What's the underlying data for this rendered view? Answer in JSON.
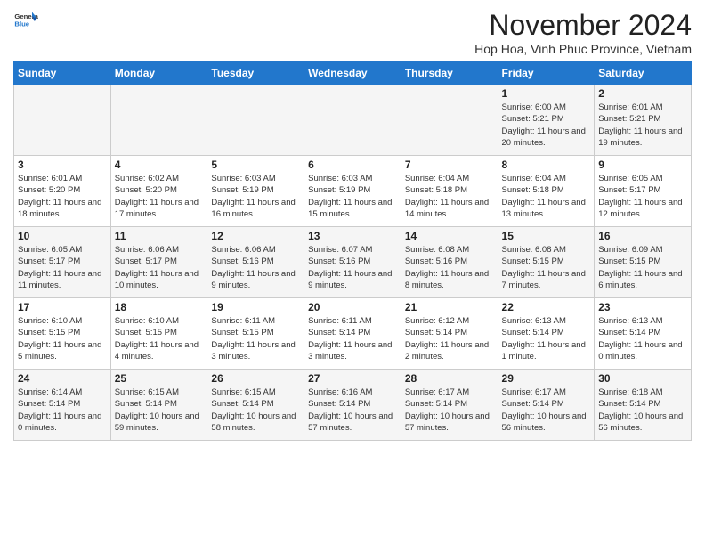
{
  "header": {
    "logo_general": "General",
    "logo_blue": "Blue",
    "month_title": "November 2024",
    "location": "Hop Hoa, Vinh Phuc Province, Vietnam"
  },
  "days_of_week": [
    "Sunday",
    "Monday",
    "Tuesday",
    "Wednesday",
    "Thursday",
    "Friday",
    "Saturday"
  ],
  "weeks": [
    [
      {
        "day": "",
        "info": ""
      },
      {
        "day": "",
        "info": ""
      },
      {
        "day": "",
        "info": ""
      },
      {
        "day": "",
        "info": ""
      },
      {
        "day": "",
        "info": ""
      },
      {
        "day": "1",
        "info": "Sunrise: 6:00 AM\nSunset: 5:21 PM\nDaylight: 11 hours and 20 minutes."
      },
      {
        "day": "2",
        "info": "Sunrise: 6:01 AM\nSunset: 5:21 PM\nDaylight: 11 hours and 19 minutes."
      }
    ],
    [
      {
        "day": "3",
        "info": "Sunrise: 6:01 AM\nSunset: 5:20 PM\nDaylight: 11 hours and 18 minutes."
      },
      {
        "day": "4",
        "info": "Sunrise: 6:02 AM\nSunset: 5:20 PM\nDaylight: 11 hours and 17 minutes."
      },
      {
        "day": "5",
        "info": "Sunrise: 6:03 AM\nSunset: 5:19 PM\nDaylight: 11 hours and 16 minutes."
      },
      {
        "day": "6",
        "info": "Sunrise: 6:03 AM\nSunset: 5:19 PM\nDaylight: 11 hours and 15 minutes."
      },
      {
        "day": "7",
        "info": "Sunrise: 6:04 AM\nSunset: 5:18 PM\nDaylight: 11 hours and 14 minutes."
      },
      {
        "day": "8",
        "info": "Sunrise: 6:04 AM\nSunset: 5:18 PM\nDaylight: 11 hours and 13 minutes."
      },
      {
        "day": "9",
        "info": "Sunrise: 6:05 AM\nSunset: 5:17 PM\nDaylight: 11 hours and 12 minutes."
      }
    ],
    [
      {
        "day": "10",
        "info": "Sunrise: 6:05 AM\nSunset: 5:17 PM\nDaylight: 11 hours and 11 minutes."
      },
      {
        "day": "11",
        "info": "Sunrise: 6:06 AM\nSunset: 5:17 PM\nDaylight: 11 hours and 10 minutes."
      },
      {
        "day": "12",
        "info": "Sunrise: 6:06 AM\nSunset: 5:16 PM\nDaylight: 11 hours and 9 minutes."
      },
      {
        "day": "13",
        "info": "Sunrise: 6:07 AM\nSunset: 5:16 PM\nDaylight: 11 hours and 9 minutes."
      },
      {
        "day": "14",
        "info": "Sunrise: 6:08 AM\nSunset: 5:16 PM\nDaylight: 11 hours and 8 minutes."
      },
      {
        "day": "15",
        "info": "Sunrise: 6:08 AM\nSunset: 5:15 PM\nDaylight: 11 hours and 7 minutes."
      },
      {
        "day": "16",
        "info": "Sunrise: 6:09 AM\nSunset: 5:15 PM\nDaylight: 11 hours and 6 minutes."
      }
    ],
    [
      {
        "day": "17",
        "info": "Sunrise: 6:10 AM\nSunset: 5:15 PM\nDaylight: 11 hours and 5 minutes."
      },
      {
        "day": "18",
        "info": "Sunrise: 6:10 AM\nSunset: 5:15 PM\nDaylight: 11 hours and 4 minutes."
      },
      {
        "day": "19",
        "info": "Sunrise: 6:11 AM\nSunset: 5:15 PM\nDaylight: 11 hours and 3 minutes."
      },
      {
        "day": "20",
        "info": "Sunrise: 6:11 AM\nSunset: 5:14 PM\nDaylight: 11 hours and 3 minutes."
      },
      {
        "day": "21",
        "info": "Sunrise: 6:12 AM\nSunset: 5:14 PM\nDaylight: 11 hours and 2 minutes."
      },
      {
        "day": "22",
        "info": "Sunrise: 6:13 AM\nSunset: 5:14 PM\nDaylight: 11 hours and 1 minute."
      },
      {
        "day": "23",
        "info": "Sunrise: 6:13 AM\nSunset: 5:14 PM\nDaylight: 11 hours and 0 minutes."
      }
    ],
    [
      {
        "day": "24",
        "info": "Sunrise: 6:14 AM\nSunset: 5:14 PM\nDaylight: 11 hours and 0 minutes."
      },
      {
        "day": "25",
        "info": "Sunrise: 6:15 AM\nSunset: 5:14 PM\nDaylight: 10 hours and 59 minutes."
      },
      {
        "day": "26",
        "info": "Sunrise: 6:15 AM\nSunset: 5:14 PM\nDaylight: 10 hours and 58 minutes."
      },
      {
        "day": "27",
        "info": "Sunrise: 6:16 AM\nSunset: 5:14 PM\nDaylight: 10 hours and 57 minutes."
      },
      {
        "day": "28",
        "info": "Sunrise: 6:17 AM\nSunset: 5:14 PM\nDaylight: 10 hours and 57 minutes."
      },
      {
        "day": "29",
        "info": "Sunrise: 6:17 AM\nSunset: 5:14 PM\nDaylight: 10 hours and 56 minutes."
      },
      {
        "day": "30",
        "info": "Sunrise: 6:18 AM\nSunset: 5:14 PM\nDaylight: 10 hours and 56 minutes."
      }
    ]
  ]
}
